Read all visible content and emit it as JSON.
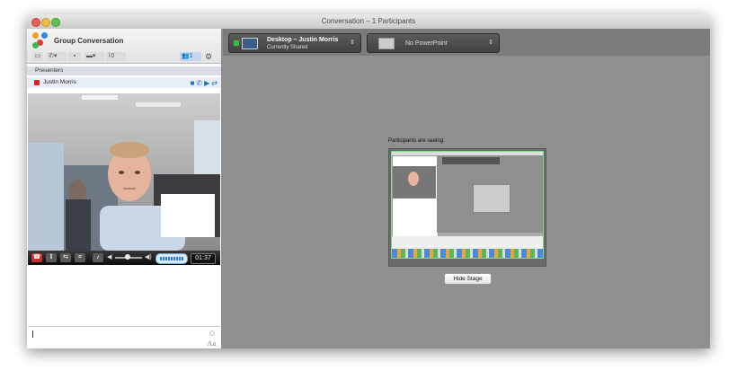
{
  "window": {
    "title": "Conversation – 1 Participants"
  },
  "conversation": {
    "title": "Group Conversation",
    "toolbar": {
      "attachments_count": "0",
      "participants_count": "1"
    },
    "presenters_label": "Presenters",
    "presenter": {
      "name": "Justin Morris"
    },
    "video": {
      "duration": "01:37"
    },
    "chat": {
      "font_label": "Aa"
    }
  },
  "stage": {
    "desktop_title": "Desktop – Justin Morris",
    "desktop_subtitle": "Currently Shared",
    "powerpoint_title": "No PowerPoint",
    "participants_seeing_label": "Participants are seeing:",
    "hide_button_label": "Hide Stage"
  },
  "icons": {
    "logo": "people-logo-icon",
    "chat": "chat-bubble-icon",
    "phone": "phone-icon",
    "video": "video-camera-icon",
    "screen": "screen-share-icon",
    "paperclip": "paperclip-icon",
    "participants": "participants-icon",
    "gear": "gear-icon",
    "hangup": "hang-up-icon",
    "pause": "pause-icon",
    "transfer": "call-transfer-icon",
    "keypad": "keypad-icon",
    "mic": "microphone-icon",
    "volume": "volume-icon",
    "smiley": "emoticon-icon"
  },
  "colors": {
    "accent": "#1a6fd0",
    "presenter_status": "#dd2222",
    "share_active": "#3cbf3c",
    "stage_border": "#7fe08a"
  }
}
